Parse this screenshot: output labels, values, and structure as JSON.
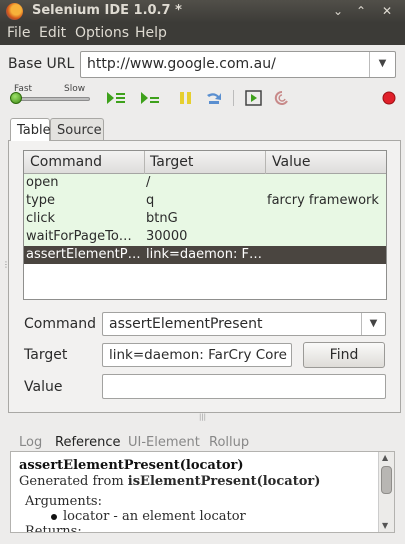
{
  "window": {
    "title": "Selenium IDE 1.0.7 *",
    "controls": [
      "⌄",
      "⌃",
      "✕"
    ]
  },
  "menu": [
    "File",
    "Edit",
    "Options",
    "Help"
  ],
  "base_url": {
    "label": "Base URL",
    "value": "http://www.google.com.au/"
  },
  "toolbar": {
    "speed_fast": "Fast",
    "speed_slow": "Slow",
    "speed_value": 0.0
  },
  "tabs": [
    "Table",
    "Source"
  ],
  "table": {
    "headers": [
      "Command",
      "Target",
      "Value"
    ],
    "rows": [
      {
        "command": "open",
        "target": "/",
        "value": ""
      },
      {
        "command": "type",
        "target": "q",
        "value": "farcry framework"
      },
      {
        "command": "click",
        "target": "btnG",
        "value": ""
      },
      {
        "command": "waitForPageTo…",
        "target": "30000",
        "value": ""
      },
      {
        "command": "assertElementP…",
        "target": "link=daemon: F…",
        "value": ""
      }
    ]
  },
  "form": {
    "command_label": "Command",
    "command_value": "assertElementPresent",
    "target_label": "Target",
    "target_value": "link=daemon: FarCry Core W",
    "find_label": "Find",
    "value_label": "Value",
    "value_value": ""
  },
  "bottom_tabs": [
    "Log",
    "Reference",
    "UI-Element",
    "Rollup"
  ],
  "reference": {
    "signature": "assertElementPresent(locator)",
    "generated_prefix": "Generated from ",
    "generated_from": "isElementPresent(locator)",
    "arguments_label": "Arguments:",
    "argument_1": "locator - an element locator",
    "returns_label": "Returns:"
  }
}
